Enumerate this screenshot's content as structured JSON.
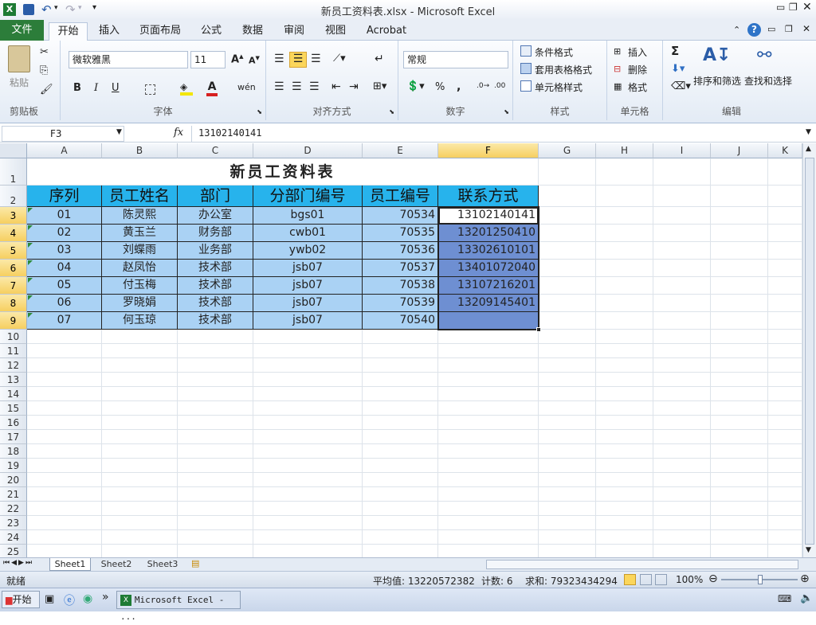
{
  "window": {
    "title": "新员工资料表.xlsx  -  Microsoft Excel"
  },
  "ribbon_tabs": [
    "文件",
    "开始",
    "插入",
    "页面布局",
    "公式",
    "数据",
    "审阅",
    "视图",
    "Acrobat"
  ],
  "ribbon": {
    "clipboard": {
      "label": "剪贴板",
      "paste": "粘贴"
    },
    "font": {
      "label": "字体",
      "name": "微软雅黑",
      "size": "11",
      "bold": "B",
      "italic": "I",
      "underline": "U"
    },
    "align": {
      "label": "对齐方式"
    },
    "number": {
      "label": "数字",
      "format": "常规",
      "percent": "%",
      "comma": ","
    },
    "styles": {
      "label": "样式",
      "cond": "条件格式",
      "table": "套用表格格式",
      "cell": "单元格样式"
    },
    "cells": {
      "label": "单元格",
      "insert": "插入",
      "delete": "删除",
      "format": "格式"
    },
    "edit": {
      "label": "编辑",
      "sort": "排序和筛选",
      "find": "查找和选择",
      "sum": "Σ"
    }
  },
  "formula_bar": {
    "name_box": "F3",
    "fx": "fx",
    "value": "13102140141"
  },
  "columns": [
    "A",
    "B",
    "C",
    "D",
    "E",
    "F",
    "G",
    "H",
    "I",
    "J",
    "K"
  ],
  "sheet": {
    "title": "新员工资料表",
    "headers": [
      "序列",
      "员工姓名",
      "部门",
      "分部门编号",
      "员工编号",
      "联系方式"
    ],
    "rows": [
      [
        "01",
        "陈灵熙",
        "办公室",
        "bgs01",
        "70534",
        "13102140141"
      ],
      [
        "02",
        "黄玉兰",
        "财务部",
        "cwb01",
        "70535",
        "13201250410"
      ],
      [
        "03",
        "刘蝶雨",
        "业务部",
        "ywb02",
        "70536",
        "13302610101"
      ],
      [
        "04",
        "赵凤怡",
        "技术部",
        "jsb07",
        "70537",
        "13401072040"
      ],
      [
        "05",
        "付玉梅",
        "技术部",
        "jsb07",
        "70538",
        "13107216201"
      ],
      [
        "06",
        "罗晓娟",
        "技术部",
        "jsb07",
        "70539",
        "13209145401"
      ],
      [
        "07",
        "何玉琼",
        "技术部",
        "jsb07",
        "70540",
        ""
      ]
    ],
    "row_numbers": [
      "1",
      "2",
      "3",
      "4",
      "5",
      "6",
      "7",
      "8",
      "9",
      "10",
      "11",
      "12",
      "13",
      "14",
      "15",
      "16",
      "17",
      "18",
      "19",
      "20",
      "21",
      "22",
      "23",
      "24",
      "25"
    ]
  },
  "sheet_tabs": [
    "Sheet1",
    "Sheet2",
    "Sheet3"
  ],
  "status": {
    "ready": "就绪",
    "average": "平均值: 13220572382",
    "count": "计数: 6",
    "sum": "求和: 79323434294",
    "zoom": "100%"
  },
  "taskbar": {
    "start": "开始",
    "app": "Microsoft Excel - ..."
  },
  "colors": {
    "header_fill": "#27b3ec",
    "body_fill": "#aad2f4",
    "selected_fill": "#6e8fd2",
    "file_tab": "#2c7d3a"
  }
}
